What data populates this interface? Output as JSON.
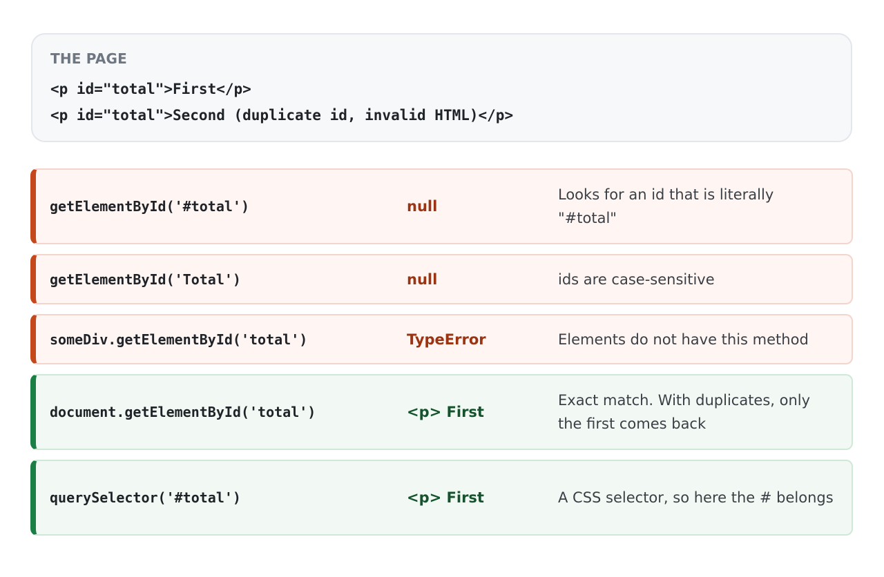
{
  "page_box": {
    "label": "THE PAGE",
    "lines": [
      "<p id=\"total\">First</p>",
      "<p id=\"total\">Second (duplicate id, invalid HTML)</p>"
    ]
  },
  "rows": [
    {
      "call": "getElementById('#total')",
      "result": "null",
      "note": "Looks for an id that is literally \"#total\"",
      "status": "bad"
    },
    {
      "call": "getElementById('Total')",
      "result": "null",
      "note": "ids are case-sensitive",
      "status": "bad"
    },
    {
      "call": "someDiv.getElementById('total')",
      "result": "TypeError",
      "note": "Elements do not have this method",
      "status": "bad"
    },
    {
      "call": "document.getElementById('total')",
      "result": "<p> First",
      "note": "Exact match. With duplicates, only the first comes back",
      "status": "good"
    },
    {
      "call": "querySelector('#total')",
      "result": "<p> First",
      "note": "A CSS selector, so here the # belongs",
      "status": "good"
    }
  ],
  "colors": {
    "bad_accent": "#c4481a",
    "good_accent": "#1a7f45"
  }
}
